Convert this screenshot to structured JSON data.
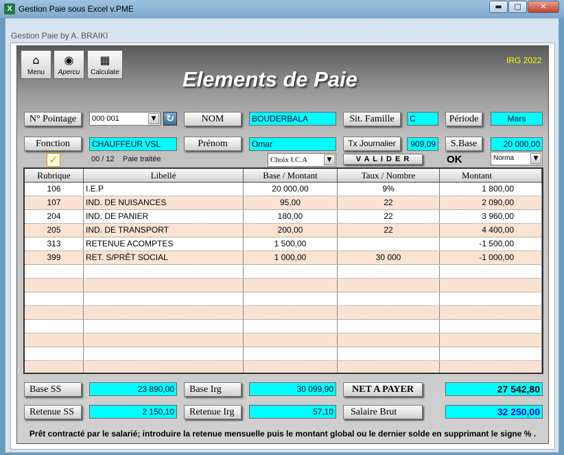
{
  "window": {
    "title": "Gestion Paie sous Excel v.PME",
    "app_icon": "X",
    "controls": {
      "minimize": "▬",
      "maximize": "□",
      "close": "✕"
    }
  },
  "form": {
    "title": "Gestion Paie by A. BRAIKI"
  },
  "toolbar": {
    "menu_label": "Menu",
    "apercu_label": "Apercu",
    "calculate_label": "Calculate"
  },
  "header": {
    "irg_label": "IRG 2022",
    "page_title": "Elements de Paie"
  },
  "fields": {
    "pointage_label": "N° Pointage",
    "pointage_value": "000 001",
    "nom_label": "NOM",
    "nom_value": "BOUDERBALA",
    "sit_famille_label": "Sit. Famille",
    "sit_famille_value": "C",
    "periode_label": "Période",
    "periode_value": "Mars",
    "fonction_label": "Fonction",
    "fonction_value": "CHAUFFEUR VSL",
    "prenom_label": "Prénom",
    "prenom_value": "Omar",
    "tx_journalier_label": "Tx Journalier",
    "tx_journalier_value": "909,09",
    "sbase_label": "S.Base",
    "sbase_value": "20 000,00",
    "progress_count": "00 / 12",
    "progress_text": "Paie traitée",
    "choix_ica": "Choix I.C.A",
    "valider_label": "V A L I D E R",
    "ok_label": "OK",
    "norma_value": "Norma"
  },
  "table": {
    "columns": [
      "Rubrique",
      "Libellé",
      "Base / Montant",
      "Taux / Nombre",
      "Montant"
    ],
    "rows": [
      [
        "106",
        "I.E.P",
        "20 000,00",
        "9%",
        "1 800,00"
      ],
      [
        "107",
        "IND. DE NUISANCES",
        "95,00",
        "22",
        "2 090,00"
      ],
      [
        "204",
        "IND. DE PANIER",
        "180,00",
        "22",
        "3 960,00"
      ],
      [
        "205",
        "IND. DE TRANSPORT",
        "200,00",
        "22",
        "4 400,00"
      ],
      [
        "313",
        "RETENUE ACOMPTES",
        "1 500,00",
        "",
        "-1 500,00"
      ],
      [
        "399",
        "RET. S/PRÊT SOCIAL",
        "1 000,00",
        "30 000",
        "-1 000,00"
      ],
      [
        "",
        "",
        "",
        "",
        ""
      ],
      [
        "",
        "",
        "",
        "",
        ""
      ],
      [
        "",
        "",
        "",
        "",
        ""
      ],
      [
        "",
        "",
        "",
        "",
        ""
      ],
      [
        "",
        "",
        "",
        "",
        ""
      ],
      [
        "",
        "",
        "",
        "",
        ""
      ],
      [
        "",
        "",
        "",
        "",
        ""
      ],
      [
        "",
        "",
        "",
        "",
        ""
      ]
    ]
  },
  "totals": {
    "base_ss_label": "Base SS",
    "base_ss_value": "23 890,00",
    "base_irg_label": "Base Irg",
    "base_irg_value": "30 099,90",
    "net_label": "NET A PAYER",
    "net_value": "27 542,80",
    "retenue_ss_label": "Retenue SS",
    "retenue_ss_value": "2 150,10",
    "retenue_irg_label": "Retenue Irg",
    "retenue_irg_value": "57,10",
    "salaire_brut_label": "Salaire Brut",
    "salaire_brut_value": "32 250,00"
  },
  "footer": {
    "note": "Prêt contracté par le salarié; introduire la retenue mensuelle puis le montant global ou le dernier solde en supprimant le signe  % ."
  },
  "colors": {
    "field_bg": "#00ffff",
    "row_alt": "#fbe3d3",
    "irg": "#ffff00",
    "net_text": "#000000",
    "brut_text": "#0000cc"
  }
}
